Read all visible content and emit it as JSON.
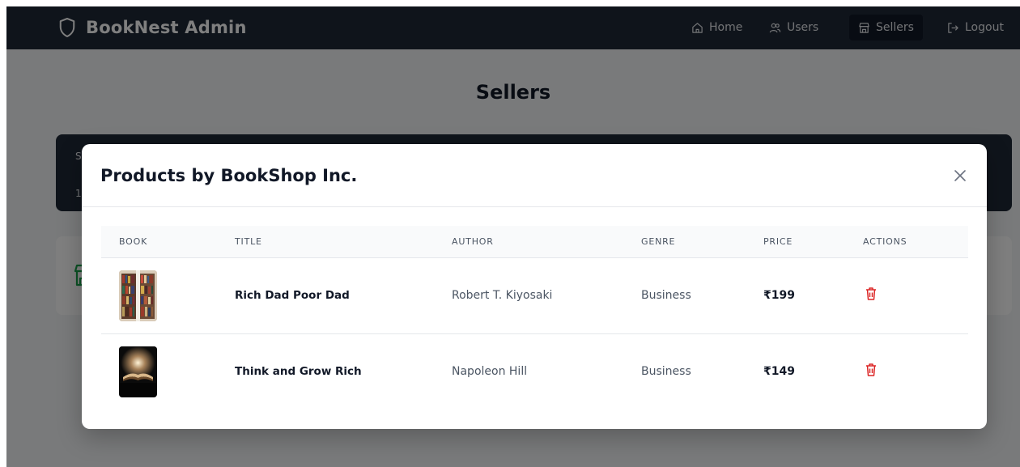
{
  "brand": {
    "name": "BookNest Admin",
    "icon": "shield-icon"
  },
  "nav": {
    "home": "Home",
    "users": "Users",
    "sellers": "Sellers",
    "logout": "Logout",
    "active": "Sellers"
  },
  "page": {
    "title": "Sellers",
    "table_peek": {
      "header_fragment": "S",
      "row_fragment": "1"
    }
  },
  "modal": {
    "title": "Products by BookShop Inc.",
    "columns": [
      "BOOK",
      "TITLE",
      "AUTHOR",
      "GENRE",
      "PRICE",
      "ACTIONS"
    ],
    "rows": [
      {
        "title": "Rich Dad Poor Dad",
        "author": "Robert T. Kiyosaki",
        "genre": "Business",
        "price": "₹199",
        "thumbnail": "bookshelf-photo",
        "action_icon": "trash-icon"
      },
      {
        "title": "Think and Grow Rich",
        "author": "Napoleon Hill",
        "genre": "Business",
        "price": "₹149",
        "thumbnail": "open-book-light-photo",
        "action_icon": "trash-icon"
      }
    ]
  },
  "colors": {
    "navbar": "#1f2937",
    "nav_active": "#111827",
    "delete": "#dc2626",
    "store_icon": "#16a34a"
  }
}
